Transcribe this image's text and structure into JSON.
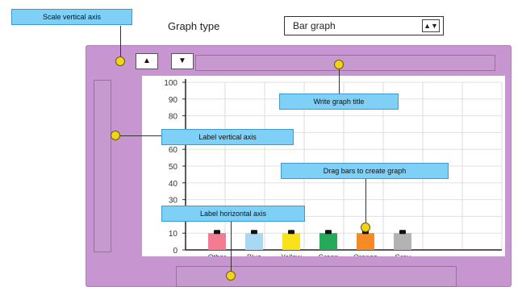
{
  "graph_type": {
    "label": "Graph type",
    "selected": "Bar graph",
    "arrow_glyph": "▲▼"
  },
  "scale_buttons": {
    "up_glyph": "▲",
    "down_glyph": "▼"
  },
  "callouts": {
    "scale": "Scale vertical axis",
    "title": "Write graph title",
    "ylabel": "Label vertical axis",
    "drag": "Drag bars to create graph",
    "xlabel": "Label horizontal axis"
  },
  "chart_data": {
    "type": "bar",
    "categories": [
      "Other",
      "Blue",
      "Yellow",
      "Green",
      "Orange",
      "Gray"
    ],
    "values": [
      10,
      10,
      10,
      10,
      10,
      10
    ],
    "colors": [
      "#f47c92",
      "#a9d8f5",
      "#f7e21c",
      "#27a95b",
      "#f58b27",
      "#b3b3b3"
    ],
    "ylim": [
      0,
      100
    ],
    "yticks": [
      "0",
      "10",
      "20",
      "30",
      "40",
      "50",
      "60",
      "70",
      "80",
      "90",
      "100"
    ],
    "grid": true
  }
}
